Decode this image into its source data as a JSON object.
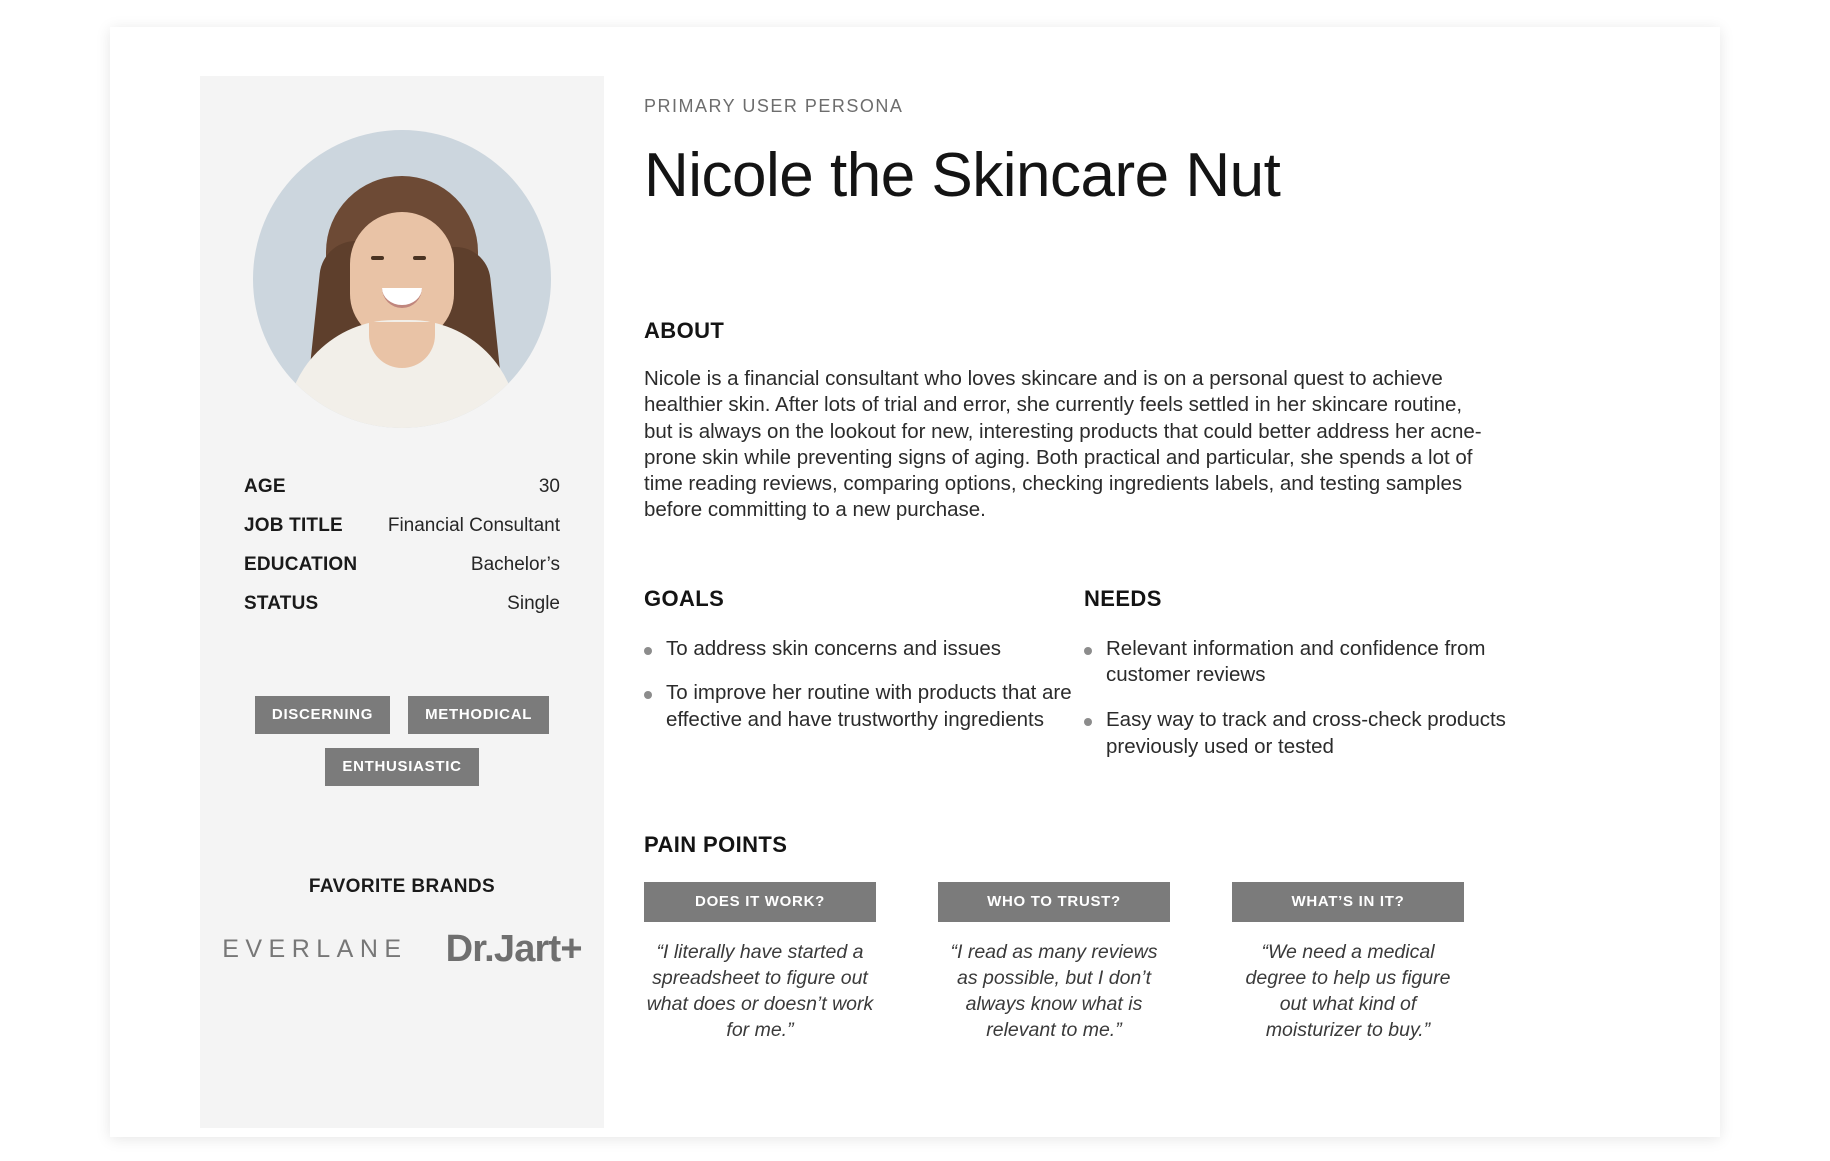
{
  "persona": {
    "eyebrow": "PRIMARY USER PERSONA",
    "headline": "Nicole the Skincare Nut"
  },
  "about": {
    "title": "ABOUT",
    "body": "Nicole is a financial consultant who loves skincare and is on a personal quest to achieve healthier skin.  After lots of trial and error, she currently feels settled in her skincare routine, but is always on the lookout for new, interesting products that could better address her acne-prone skin while preventing signs of aging.  Both practical and particular, she spends a lot of time reading reviews, comparing options, checking ingredients labels, and testing samples before committing to a new purchase."
  },
  "details": [
    {
      "label": "AGE",
      "value": "30"
    },
    {
      "label": "JOB TITLE",
      "value": "Financial Consultant"
    },
    {
      "label": "EDUCATION",
      "value": "Bachelor’s"
    },
    {
      "label": "STATUS",
      "value": "Single"
    }
  ],
  "tags": [
    "DISCERNING",
    "METHODICAL",
    "ENTHUSIASTIC"
  ],
  "brands": {
    "title": "FAVORITE BRANDS",
    "items": [
      "EVERLANE",
      "Dr.Jart+"
    ]
  },
  "goals": {
    "title": "GOALS",
    "items": [
      "To address skin concerns and issues",
      "To improve her routine with products that are effective and have trustworthy ingredients"
    ]
  },
  "needs": {
    "title": "NEEDS",
    "items": [
      "Relevant information and confidence from customer reviews",
      "Easy way to track and cross-check products previously used or tested"
    ]
  },
  "pain_points": {
    "title": "PAIN POINTS",
    "cards": [
      {
        "heading": "DOES IT WORK?",
        "quote": "“I literally have started a spreadsheet to figure out what does or doesn’t work for me.”"
      },
      {
        "heading": "WHO TO TRUST?",
        "quote": "“I read as many reviews as possible, but I don’t always know what is relevant to me.”"
      },
      {
        "heading": "WHAT’S IN IT?",
        "quote": "“We need a medical degree to help us figure out what kind of moisturizer to buy.”"
      }
    ]
  },
  "colors": {
    "sidebar_bg": "#f4f4f4",
    "tag_bg": "#7b7b7b",
    "portrait_bg": "#ccd6de",
    "text_dark": "#141414",
    "text_body": "#2b2b2b",
    "muted": "#6d6d6d"
  }
}
